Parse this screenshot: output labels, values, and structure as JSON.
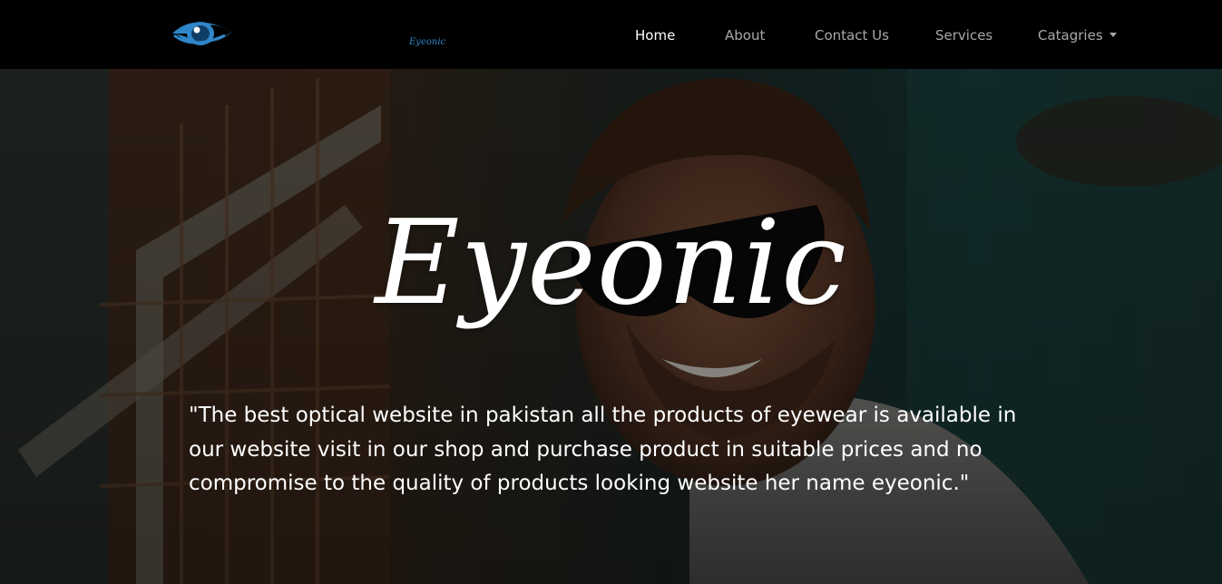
{
  "brand": {
    "logo_icon": "eye-icon",
    "logo_text": "Eyeonic"
  },
  "nav": {
    "items": [
      {
        "label": "Home",
        "active": true
      },
      {
        "label": "About",
        "active": false
      },
      {
        "label": "Contact Us",
        "active": false
      },
      {
        "label": "Services",
        "active": false
      },
      {
        "label": "Catagries",
        "active": false,
        "dropdown": true
      }
    ]
  },
  "hero": {
    "title": "Eyeonic",
    "description": "\"The best optical website in pakistan all the products of eyewear is available in our website visit in our shop and purchase product in suitable prices and no compromise to the quality of products looking website her name eyeonic.\""
  },
  "colors": {
    "navbar_bg": "#000000",
    "nav_active": "#ffffff",
    "nav_inactive": "#a8a8a8",
    "brand_blue": "#2f86c9"
  }
}
